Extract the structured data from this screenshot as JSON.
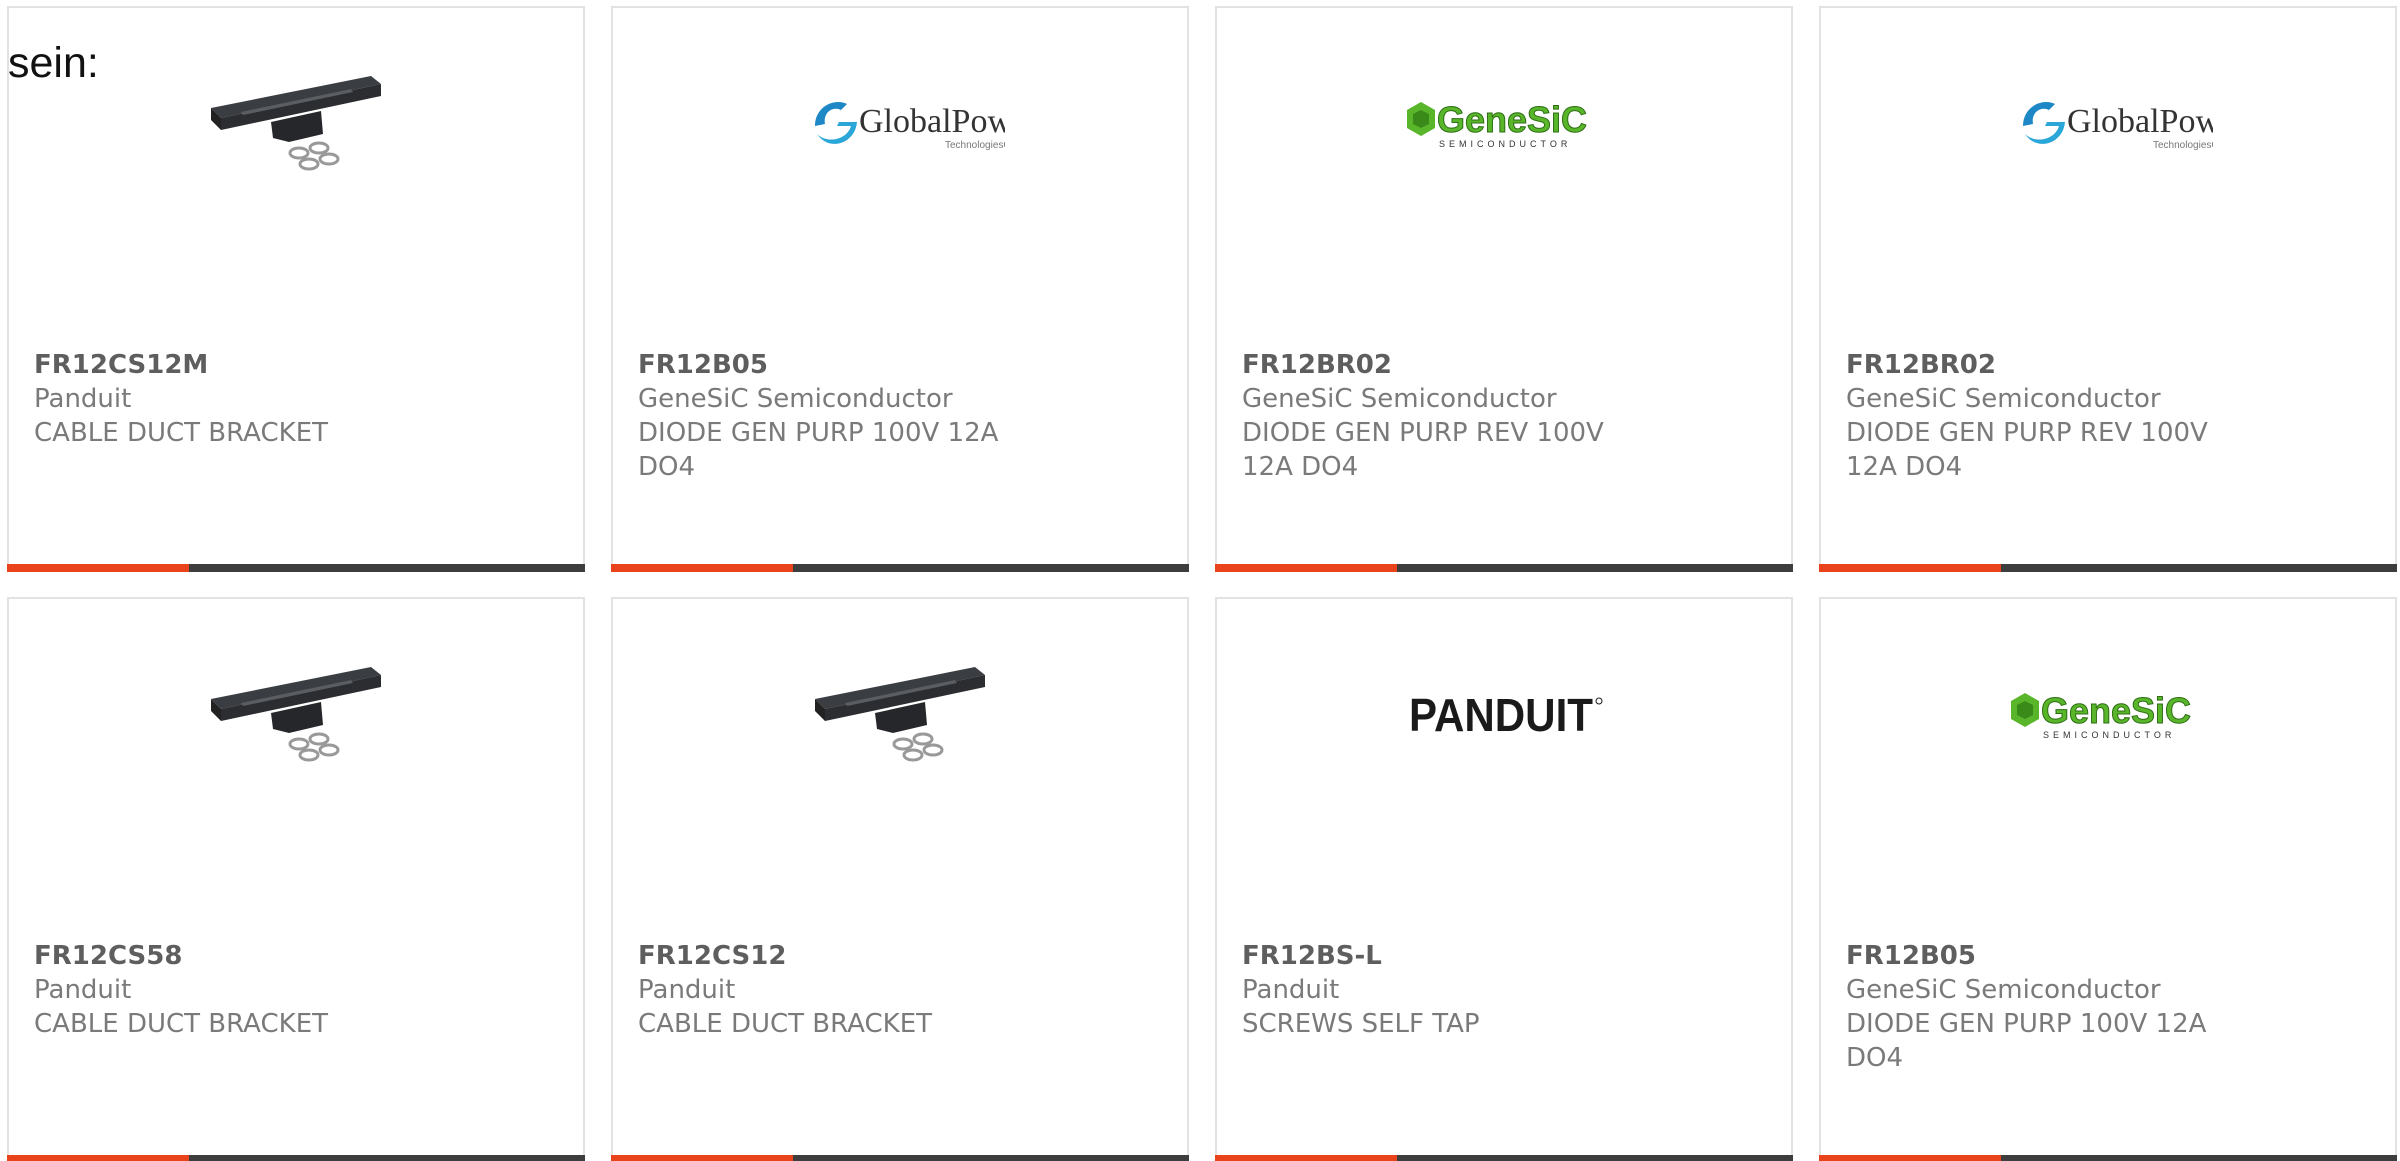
{
  "intro_text": "sein:",
  "colors": {
    "accent": "#e8431a",
    "bar": "#3d3d3d",
    "genesic_green": "#59b52a",
    "globalpower_blue": "#1e88c7"
  },
  "products": [
    {
      "part_number": "FR12CS12M",
      "manufacturer": "Panduit",
      "description": "CABLE DUCT BRACKET",
      "image": "bracket-product-image"
    },
    {
      "part_number": "FR12B05",
      "manufacturer": "GeneSiC Semiconductor",
      "description": "DIODE GEN PURP 100V 12A DO4",
      "image": "globalpower-logo",
      "logo_text": "GlobalPower",
      "logo_subtext": "TechnologiesGroup"
    },
    {
      "part_number": "FR12BR02",
      "manufacturer": "GeneSiC Semiconductor",
      "description": "DIODE GEN PURP REV 100V 12A DO4",
      "image": "genesic-logo",
      "logo_text": "GeneSiC",
      "logo_subtext": "SEMICONDUCTOR"
    },
    {
      "part_number": "FR12BR02",
      "manufacturer": "GeneSiC Semiconductor",
      "description": "DIODE GEN PURP REV 100V 12A DO4",
      "image": "globalpower-logo",
      "logo_text": "GlobalPower",
      "logo_subtext": "TechnologiesGroup"
    },
    {
      "part_number": "FR12CS58",
      "manufacturer": "Panduit",
      "description": "CABLE DUCT BRACKET",
      "image": "bracket-product-image"
    },
    {
      "part_number": "FR12CS12",
      "manufacturer": "Panduit",
      "description": "CABLE DUCT BRACKET",
      "image": "bracket-product-image"
    },
    {
      "part_number": "FR12BS-L",
      "manufacturer": "Panduit",
      "description": "SCREWS SELF TAP",
      "image": "panduit-logo",
      "logo_text": "PANDUIT"
    },
    {
      "part_number": "FR12B05",
      "manufacturer": "GeneSiC Semiconductor",
      "description": "DIODE GEN PURP 100V 12A DO4",
      "image": "genesic-logo",
      "logo_text": "GeneSiC",
      "logo_subtext": "SEMICONDUCTOR"
    }
  ]
}
